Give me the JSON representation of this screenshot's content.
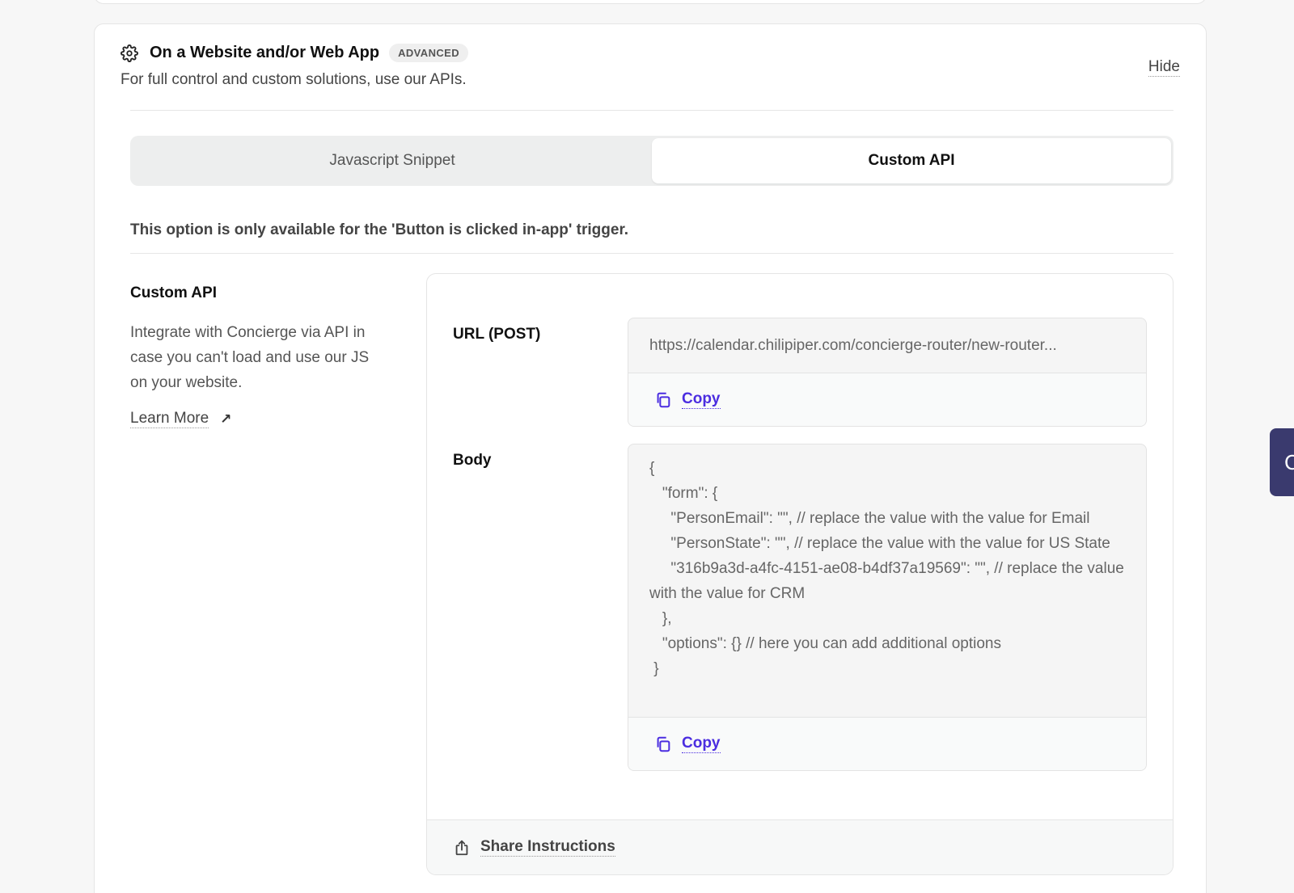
{
  "section": {
    "title": "On a Website and/or Web App",
    "badge": "ADVANCED",
    "subtitle": "For full control and custom solutions, use our APIs.",
    "hide_label": "Hide"
  },
  "tabs": [
    {
      "label": "Javascript Snippet",
      "active": false
    },
    {
      "label": "Custom API",
      "active": true
    }
  ],
  "notice": "This option is only available for the 'Button is clicked in-app' trigger.",
  "sidebar": {
    "title": "Custom API",
    "description": "Integrate with Concierge via API in case you can't load and use our JS on your website.",
    "learn_more": "Learn More"
  },
  "url_field": {
    "label": "URL (POST)",
    "value": "https://calendar.chilipiper.com/concierge-router/new-router...",
    "copy_label": "Copy"
  },
  "body_field": {
    "label": "Body",
    "value": "{\n   \"form\": {\n     \"PersonEmail\": \"\", // replace the value with the value for Email\n     \"PersonState\": \"\", // replace the value with the value for US State\n     \"316b9a3d-a4fc-4151-ae08-b4df37a19569\": \"\", // replace the value with the value for CRM\n   },\n   \"options\": {} // here you can add additional options\n }",
    "copy_label": "Copy"
  },
  "share_label": "Share Instructions",
  "side_tab_label": "C",
  "colors": {
    "accent": "#4b2de0",
    "side_tab": "#3a3a6e"
  },
  "icons": {
    "section": "gear-icon",
    "copy": "copy-icon",
    "share": "share-icon",
    "learn_more": "external-arrow-icon"
  }
}
